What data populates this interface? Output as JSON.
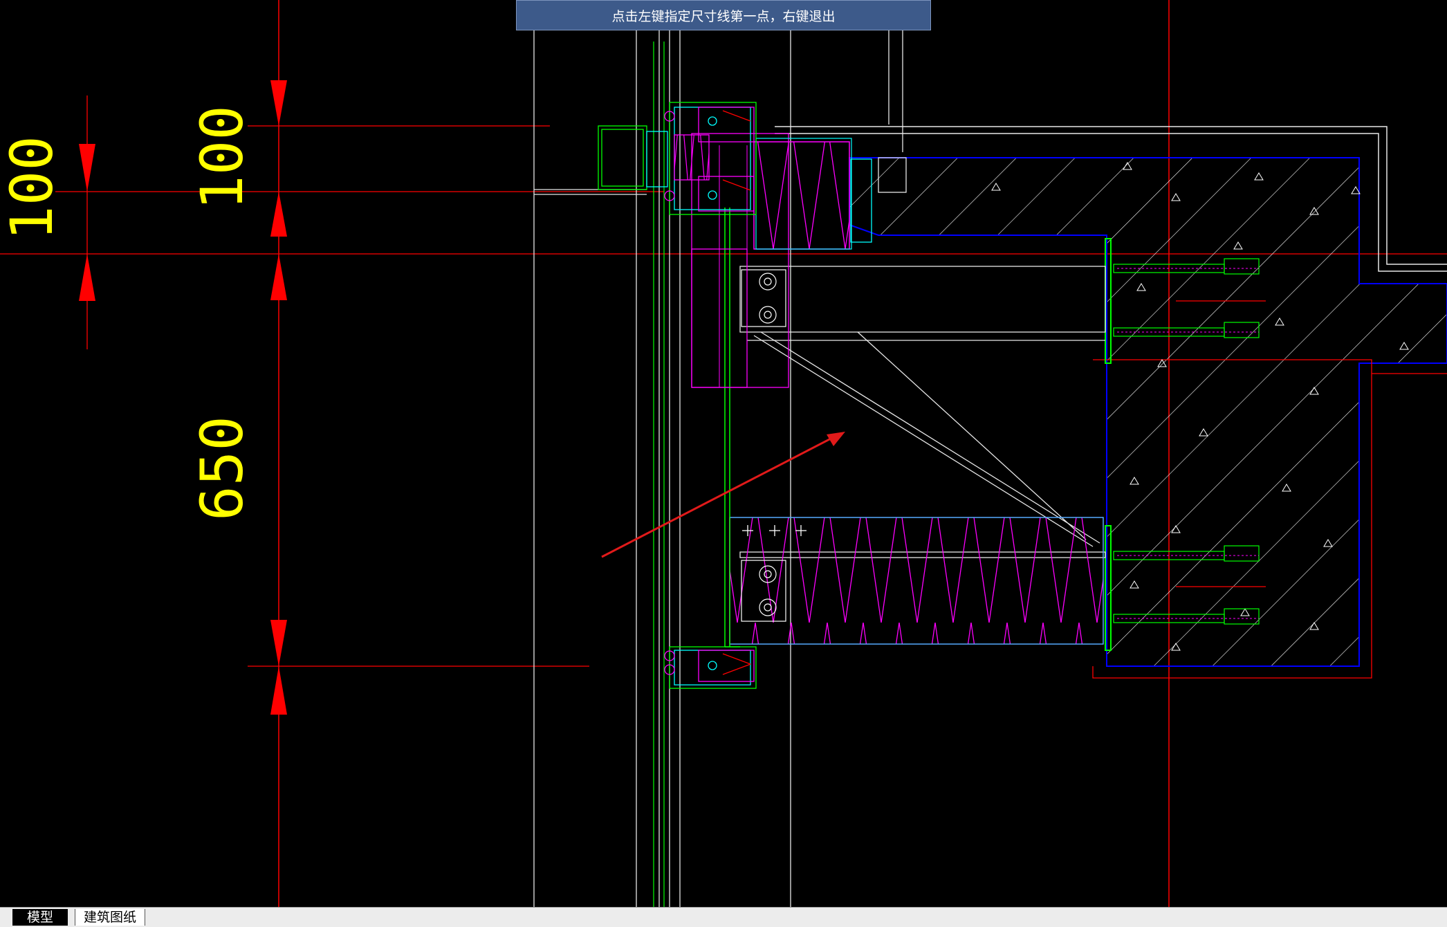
{
  "prompt": {
    "text": "点击左键指定尺寸线第一点，右键退出"
  },
  "dimensions": [
    {
      "value": "100"
    },
    {
      "value": "100"
    },
    {
      "value": "650"
    }
  ],
  "layout_tabs": [
    {
      "label": "模型",
      "active": true
    },
    {
      "label": "建筑图纸",
      "active": false
    }
  ],
  "colors": {
    "background": "#000000",
    "dimension_line": "#ff0000",
    "dimension_text": "#ffff00",
    "insulation": "#ff00ff",
    "profile": "#00ff00",
    "concrete": "#0000ff",
    "annotation_arrow": "#e11a1a"
  }
}
